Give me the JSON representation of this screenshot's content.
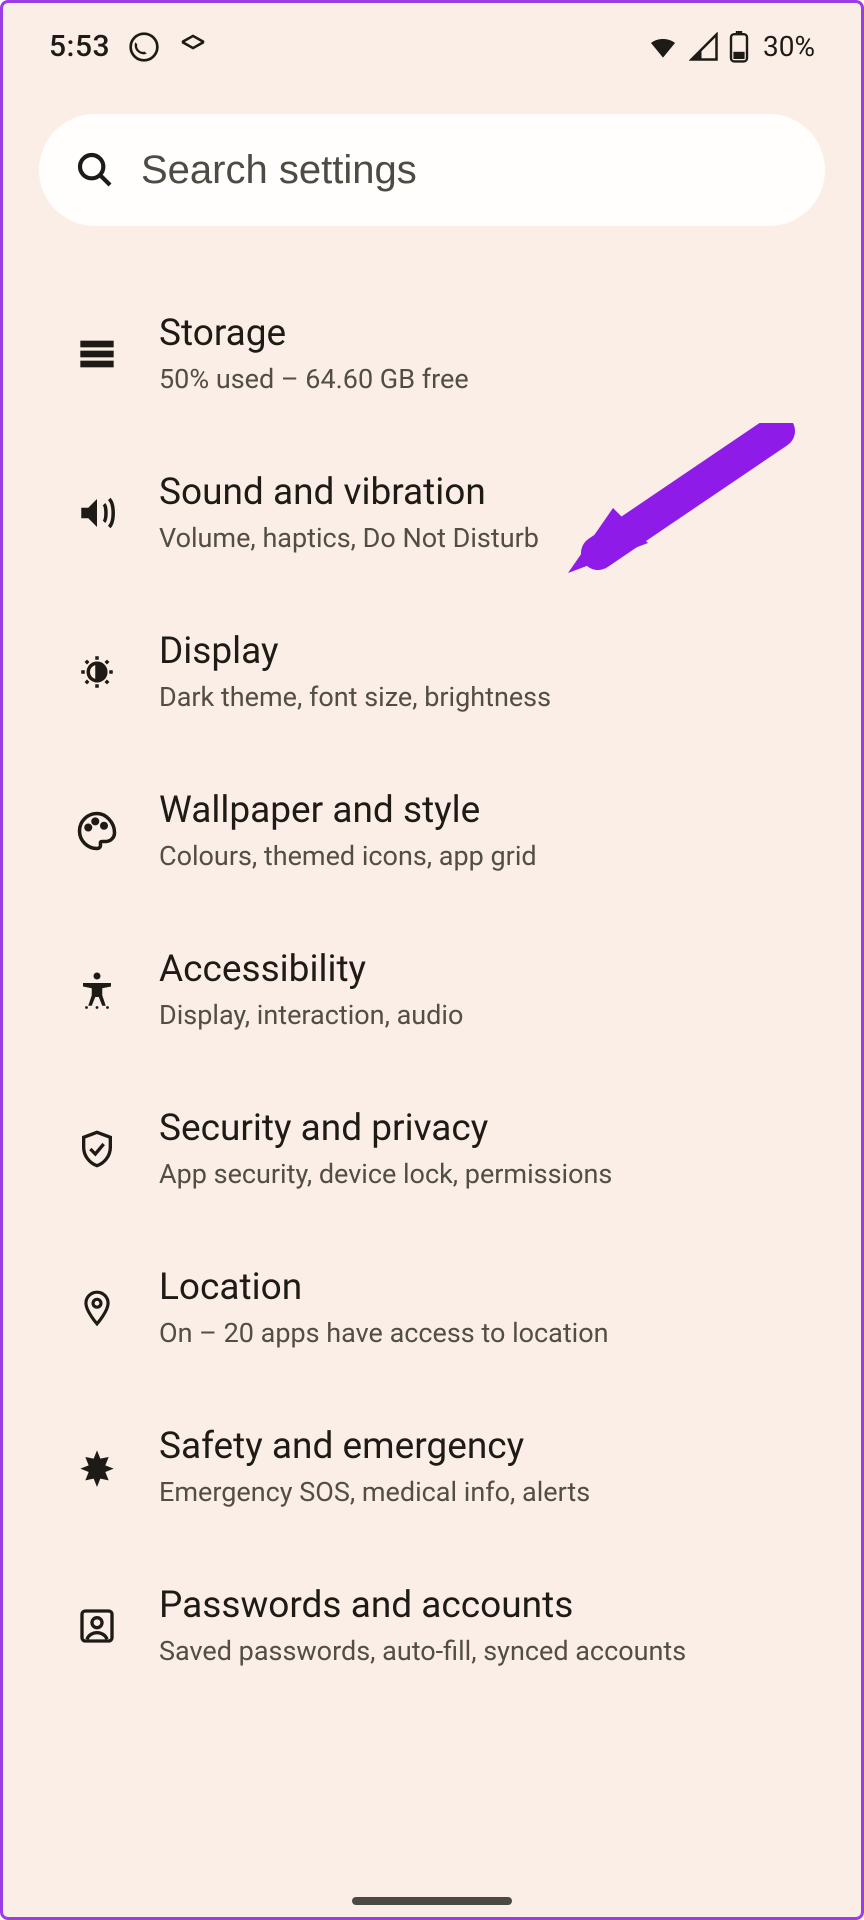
{
  "status": {
    "time": "5:53",
    "battery_pct": "30%"
  },
  "search": {
    "placeholder": "Search settings"
  },
  "items": [
    {
      "icon": "storage",
      "title": "Storage",
      "sub": "50% used – 64.60 GB free"
    },
    {
      "icon": "sound",
      "title": "Sound and vibration",
      "sub": "Volume, haptics, Do Not Disturb"
    },
    {
      "icon": "display",
      "title": "Display",
      "sub": "Dark theme, font size, brightness"
    },
    {
      "icon": "palette",
      "title": "Wallpaper and style",
      "sub": "Colours, themed icons, app grid"
    },
    {
      "icon": "a11y",
      "title": "Accessibility",
      "sub": "Display, interaction, audio"
    },
    {
      "icon": "shield",
      "title": "Security and privacy",
      "sub": "App security, device lock, permissions"
    },
    {
      "icon": "location",
      "title": "Location",
      "sub": "On – 20 apps have access to location"
    },
    {
      "icon": "medical",
      "title": "Safety and emergency",
      "sub": "Emergency SOS, medical info, alerts"
    },
    {
      "icon": "account",
      "title": "Passwords and accounts",
      "sub": "Saved passwords, auto-fill, synced accounts"
    }
  ],
  "annotation": {
    "target_index": 1,
    "color": "#8f1be9"
  }
}
